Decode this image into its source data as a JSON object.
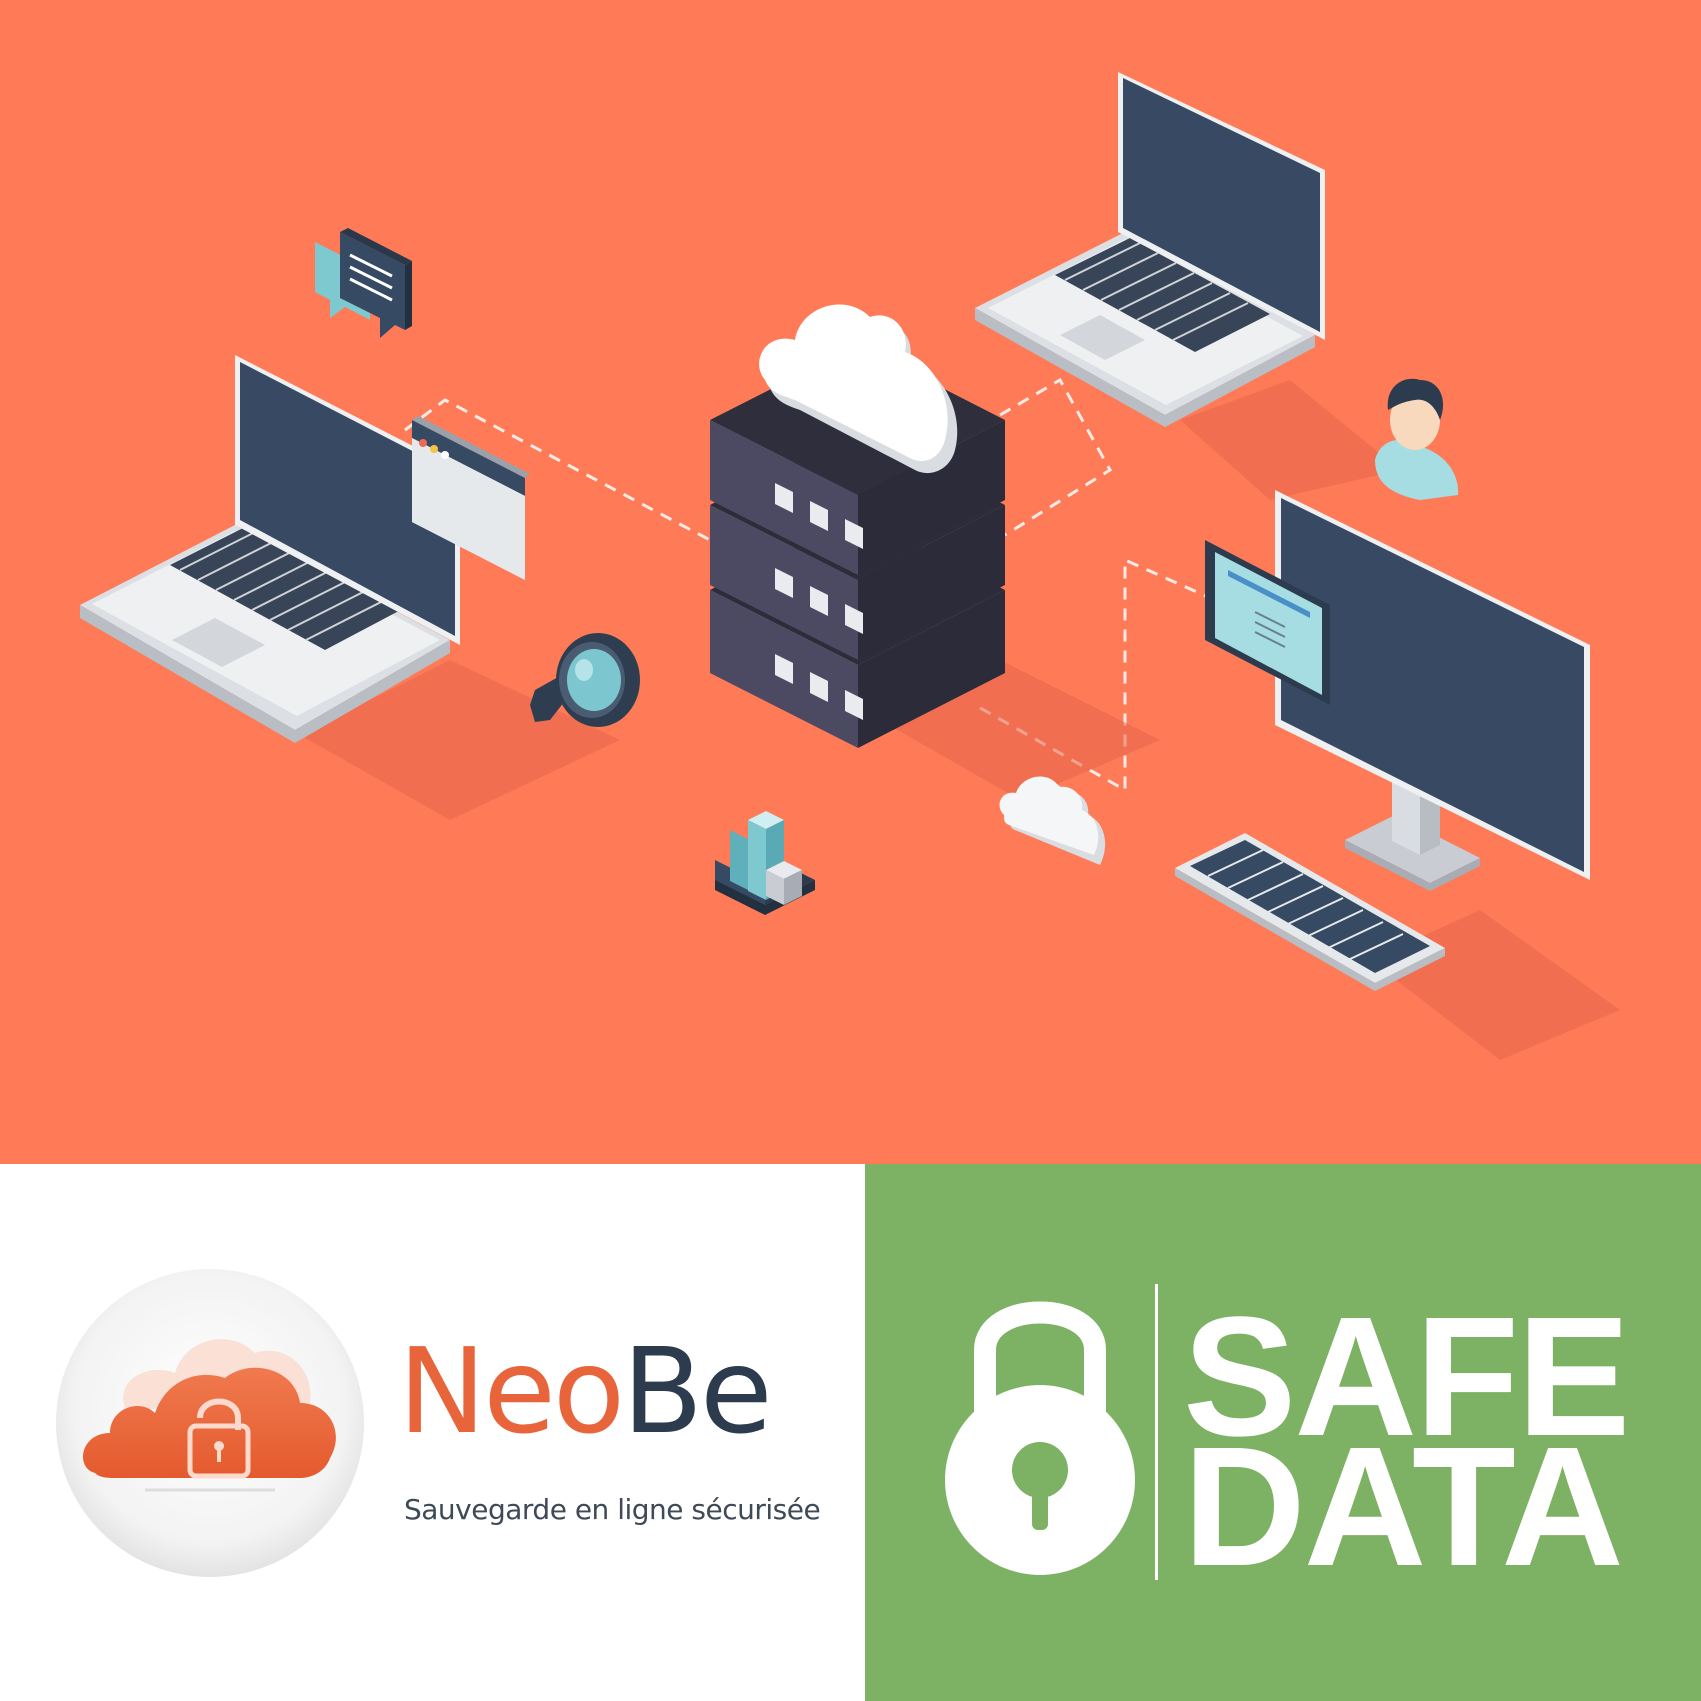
{
  "colors": {
    "hero_background": "#ff7b57",
    "brand_orange": "#e8643a",
    "brand_navy": "#2d3b4e",
    "safe_green": "#7db163",
    "server_dark": "#4a4960",
    "screen_navy": "#374a63"
  },
  "brand": {
    "name_part_1": "Neo",
    "name_part_2": "Be",
    "tagline": "Sauvegarde en ligne sécurisée"
  },
  "badge": {
    "line_1": "SAFE",
    "line_2": "DATA"
  },
  "icons": [
    "server-icon",
    "cloud-icon",
    "laptop-icon",
    "desktop-monitor-icon",
    "keyboard-icon",
    "magnifier-icon",
    "chat-bubbles-icon",
    "user-avatar-icon",
    "bar-chart-icon",
    "browser-window-icon",
    "padlock-icon",
    "cloud-lock-icon"
  ]
}
